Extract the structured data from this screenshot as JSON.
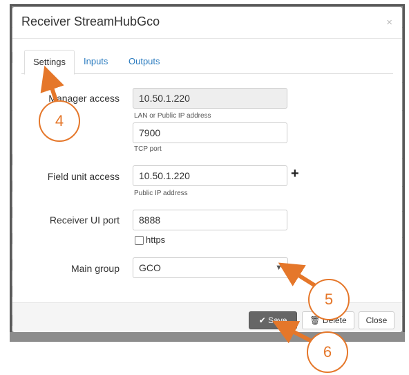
{
  "dialog": {
    "title": "Receiver StreamHubGco",
    "close_glyph": "×"
  },
  "tabs": [
    {
      "label": "Settings",
      "active": true
    },
    {
      "label": "Inputs",
      "active": false
    },
    {
      "label": "Outputs",
      "active": false
    }
  ],
  "form": {
    "manager_access": {
      "label": "Manager access",
      "ip_value": "10.50.1.220",
      "ip_help": "LAN or Public IP address",
      "port_value": "7900",
      "port_help": "TCP port"
    },
    "field_unit_access": {
      "label": "Field unit access",
      "value": "10.50.1.220",
      "help": "Public IP address",
      "add_glyph": "+"
    },
    "receiver_ui_port": {
      "label": "Receiver UI port",
      "value": "8888",
      "https_label": "https",
      "https_checked": false
    },
    "main_group": {
      "label": "Main group",
      "selected": "GCO"
    }
  },
  "footer": {
    "save_label": "✔ Save",
    "delete_label": "🗑 Delete",
    "close_label": "Close"
  },
  "annotations": [
    {
      "number": "4"
    },
    {
      "number": "5"
    },
    {
      "number": "6"
    }
  ],
  "colors": {
    "annotation": "#e5772a",
    "link": "#2a7bbf",
    "save_button": "#666666"
  }
}
